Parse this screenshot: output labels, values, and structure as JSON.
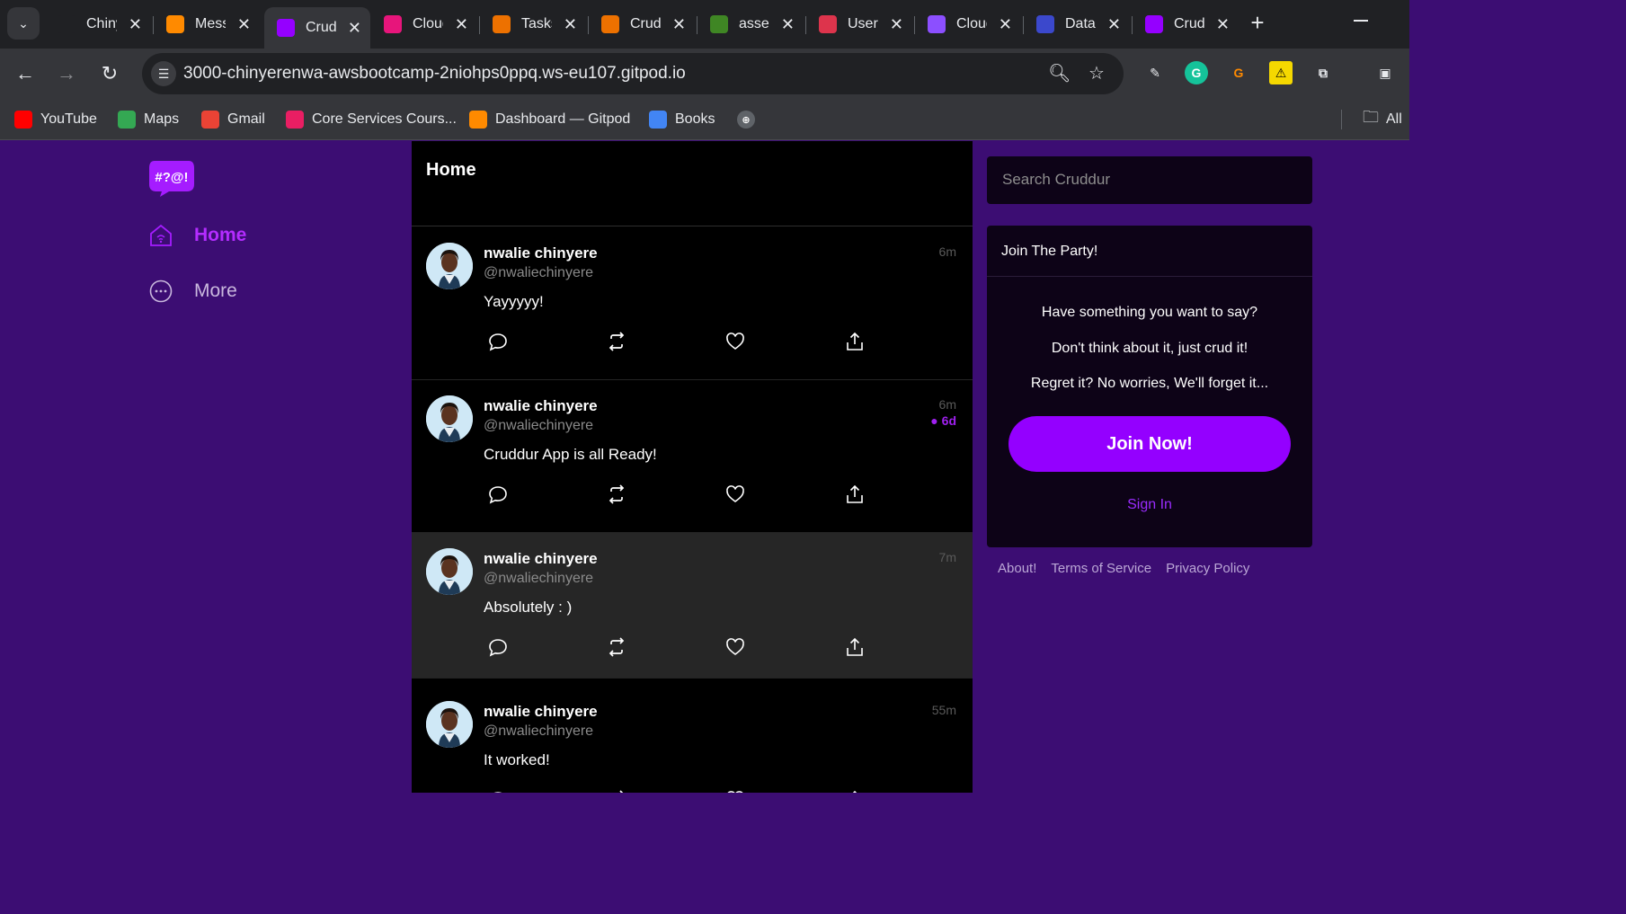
{
  "browser": {
    "tabs": [
      {
        "label": "Chinyere",
        "icon": "github-icon",
        "color": "#202124"
      },
      {
        "label": "Messages",
        "icon": "gitpod-icon",
        "color": "#ff8a00"
      },
      {
        "label": "Cruddur",
        "icon": "cruddur-icon",
        "color": "#9500ff"
      },
      {
        "label": "CloudWatch",
        "icon": "cloudwatch-icon",
        "color": "#e7157b"
      },
      {
        "label": "Tasks",
        "icon": "ecs-icon",
        "color": "#ed7100"
      },
      {
        "label": "Cruddur",
        "icon": "lambda-icon",
        "color": "#ed7100"
      },
      {
        "label": "assets",
        "icon": "s3-icon",
        "color": "#3f8624"
      },
      {
        "label": "Users",
        "icon": "cognito-icon",
        "color": "#dd344c"
      },
      {
        "label": "CloudFront",
        "icon": "cloudfront-icon",
        "color": "#8c4fff"
      },
      {
        "label": "Databases",
        "icon": "rds-icon",
        "color": "#3b48cc"
      },
      {
        "label": "Cruddur",
        "icon": "cruddur-icon",
        "color": "#9500ff"
      }
    ],
    "url": "3000-chinyerenwa-awsbootcamp-2niohps0ppq.ws-eu107.gitpod.io",
    "bookmarks": [
      {
        "label": "YouTube",
        "icon": "youtube-icon",
        "color": "#ff0000"
      },
      {
        "label": "Maps",
        "icon": "maps-icon",
        "color": "#34a853"
      },
      {
        "label": "Gmail",
        "icon": "gmail-icon",
        "color": "#ea4335"
      },
      {
        "label": "Core Services Cours...",
        "icon": "course-icon",
        "color": "#e91e63"
      },
      {
        "label": "Dashboard — Gitpod",
        "icon": "gitpod-icon",
        "color": "#ff8a00"
      },
      {
        "label": "Books",
        "icon": "google-icon",
        "color": "#4285f4"
      }
    ],
    "all_bookmarks": "All"
  },
  "app": {
    "logo_text": "#?@!",
    "nav": {
      "home": "Home",
      "more": "More"
    },
    "feed_title": "Home",
    "activities": [
      {
        "name": "nwalie chinyere",
        "handle": "@nwaliechinyere",
        "time": "6m",
        "expires": "",
        "message": "Yayyyyy!"
      },
      {
        "name": "nwalie chinyere",
        "handle": "@nwaliechinyere",
        "time": "6m",
        "expires": "6d",
        "message": "Cruddur App is all Ready!"
      },
      {
        "name": "nwalie chinyere",
        "handle": "@nwaliechinyere",
        "time": "7m",
        "expires": "",
        "message": "Absolutely : )"
      },
      {
        "name": "nwalie chinyere",
        "handle": "@nwaliechinyere",
        "time": "55m",
        "expires": "",
        "message": "It worked!"
      }
    ],
    "search_placeholder": "Search Cruddur",
    "join": {
      "title": "Join The Party!",
      "line1": "Have something you want to say?",
      "line2": "Don't think about it, just crud it!",
      "line3": "Regret it? No worries, We'll forget it...",
      "button": "Join Now!",
      "signin": "Sign In"
    },
    "footer": {
      "about": "About!",
      "terms": "Terms of Service",
      "privacy": "Privacy Policy"
    }
  }
}
